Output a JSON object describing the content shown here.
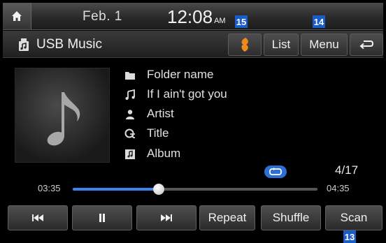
{
  "status_bar": {
    "date": "Feb.  1",
    "time": "12:08",
    "ampm": "AM"
  },
  "header": {
    "source_title": "USB Music",
    "list_label": "List",
    "menu_label": "Menu"
  },
  "track_info": {
    "folder": "Folder name",
    "song": "If I ain't got you",
    "artist": "Artist",
    "title": "Title",
    "album": "Album"
  },
  "track_count": "4/17",
  "progress": {
    "elapsed": "03:35",
    "total": "04:35",
    "fraction": 0.35
  },
  "controls": {
    "repeat_label": "Repeat",
    "shuffle_label": "Shuffle",
    "scan_label": "Scan"
  },
  "callouts": {
    "c13": "13",
    "c14": "14",
    "c15": "15"
  },
  "colors": {
    "accent": "#3a86f0",
    "callout": "#1a5cc8",
    "sound_icon": "#f08a1c"
  },
  "icons": [
    "home-icon",
    "usb-music-icon",
    "sound-effect-icon",
    "back-icon",
    "music-note-icon",
    "folder-icon",
    "song-icon",
    "artist-icon",
    "title-icon",
    "album-icon",
    "repeat-icon",
    "previous-icon",
    "pause-icon",
    "next-icon"
  ]
}
